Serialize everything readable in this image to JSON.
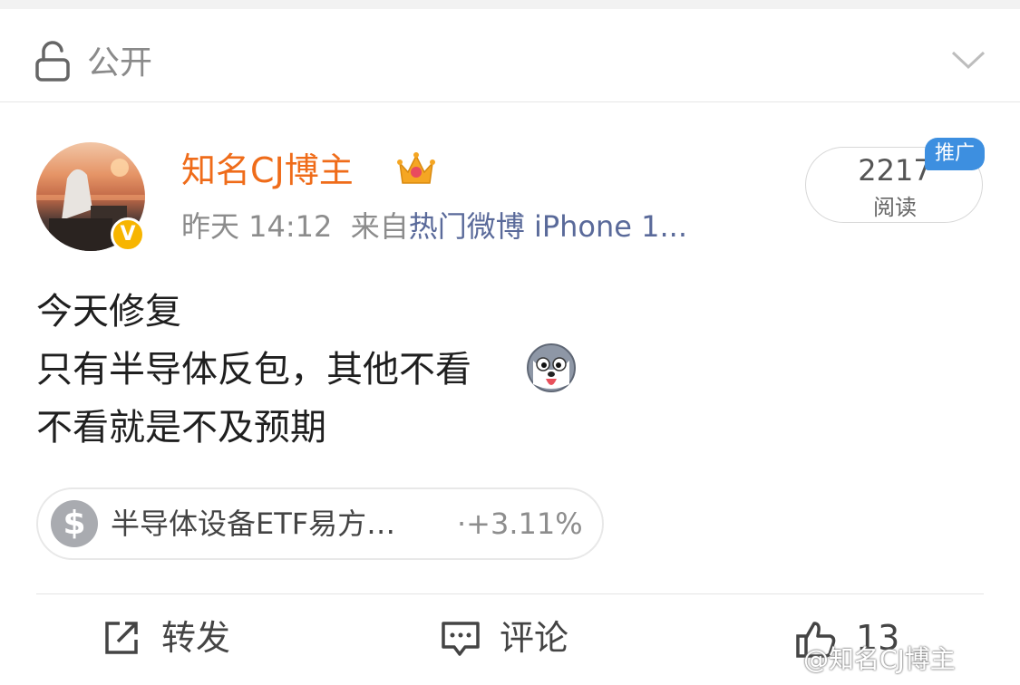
{
  "visibility": {
    "label": "公开",
    "icon": "lock-open-icon",
    "toggle_icon": "chevron-down-icon"
  },
  "post": {
    "author": "知名CJ博主",
    "verified_badge": "V",
    "time": "昨天 14:12",
    "source_prefix": "来自",
    "source": "热门微博 iPhone 1...",
    "reads_count": "2217",
    "reads_label": "阅读",
    "promo_tag": "推广",
    "lines": [
      "今天修复",
      "只有半导体反包，其他不看",
      "不看就是不及预期"
    ],
    "emoji": "husky-emoji"
  },
  "stock": {
    "icon_text": "$",
    "name": "半导体设备ETF易方…",
    "change": "·+3.11%"
  },
  "actions": {
    "repost": "转发",
    "comment": "评论",
    "like": "13"
  },
  "watermark": "@知名CJ博主",
  "colors": {
    "username": "#ef6c1a",
    "promo": "#3d8fe0",
    "verified": "#f7b500",
    "source": "#5a6a9a"
  }
}
